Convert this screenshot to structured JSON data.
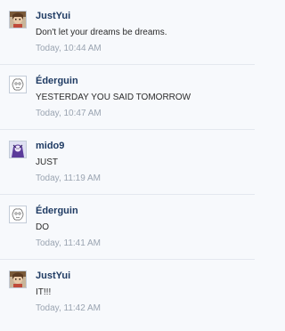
{
  "posts": [
    {
      "user": "JustYui",
      "message": "Don't let your dreams be dreams.",
      "time": "Today, 10:44 AM",
      "avatar_icon": "anime-girl-avatar-icon"
    },
    {
      "user": "Éderguin",
      "message": "YESTERDAY YOU SAID TOMORROW",
      "time": "Today, 10:47 AM",
      "avatar_icon": "sketch-face-avatar-icon"
    },
    {
      "user": "mido9",
      "message": "JUST",
      "time": "Today, 11:19 AM",
      "avatar_icon": "purple-character-avatar-icon"
    },
    {
      "user": "Éderguin",
      "message": "DO",
      "time": "Today, 11:41 AM",
      "avatar_icon": "sketch-face-avatar-icon"
    },
    {
      "user": "JustYui",
      "message": "IT!!!",
      "time": "Today, 11:42 AM",
      "avatar_icon": "anime-girl-avatar-icon"
    }
  ],
  "colors": {
    "background": "#f7f9fc",
    "username": "#1f3b63",
    "message": "#2b2b2b",
    "timestamp": "#9aa4b1",
    "divider": "#e4e8ef"
  }
}
